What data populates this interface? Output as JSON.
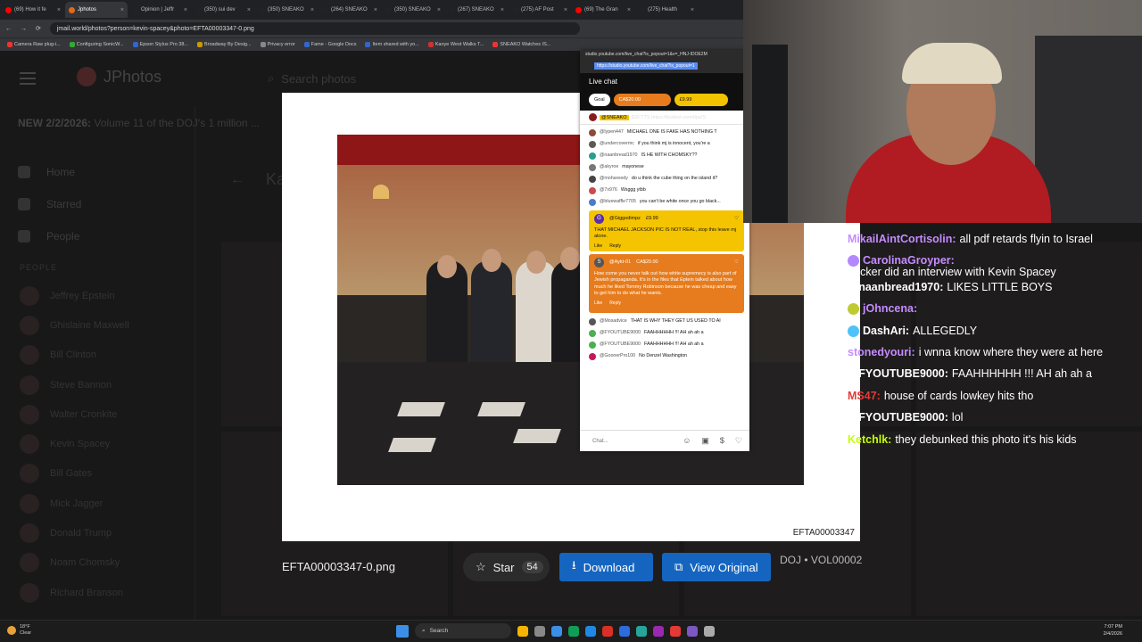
{
  "browser": {
    "tabs": [
      {
        "label": "(69) How it fe",
        "color": "#ff0000"
      },
      {
        "label": "Jphotos",
        "color": "#e06a1b",
        "active": true
      },
      {
        "label": "Opinion | Jeffr",
        "color": "#222222"
      },
      {
        "label": "(350) sui dev",
        "color": "#222222"
      },
      {
        "label": "(350) SNEAKO",
        "color": "#222222"
      },
      {
        "label": "(264) SNEAKO",
        "color": "#222222"
      },
      {
        "label": "(350) SNEAKO",
        "color": "#222222"
      },
      {
        "label": "(267) SNEAKO",
        "color": "#222222"
      },
      {
        "label": "(275) AF Post",
        "color": "#222222"
      },
      {
        "label": "(69) The Gran",
        "color": "#ff0000"
      },
      {
        "label": "(275) Health",
        "color": "#222222"
      }
    ],
    "url": "jmail.world/photos?person=kevin-spacey&photo=EFTA00003347-0.png",
    "bookmarks": [
      {
        "label": "Camera Raw plug-i...",
        "color": "#e33"
      },
      {
        "label": "Configuring SonicW...",
        "color": "#3a3"
      },
      {
        "label": "Epson Stylus Pro 38...",
        "color": "#36c"
      },
      {
        "label": "Broadway By Desig...",
        "color": "#c90"
      },
      {
        "label": "Privacy error",
        "color": "#888"
      },
      {
        "label": "Fame - Google Docs",
        "color": "#36c"
      },
      {
        "label": "Item shared with yo...",
        "color": "#36c"
      },
      {
        "label": "Kanye West Walks T...",
        "color": "#c33"
      },
      {
        "label": "SNEAKO Watches IS...",
        "color": "#e33"
      }
    ]
  },
  "app": {
    "brand": "JPhotos",
    "search_placeholder": "Search photos",
    "banner_new": "NEW 2/2/2026:",
    "banner_text": "Volume 11 of the DOJ's 1 million ...",
    "nav": [
      "Home",
      "Starred",
      "People"
    ],
    "people_heading": "PEOPLE",
    "people": [
      "Jeffrey Epstein",
      "Ghislaine Maxwell",
      "Bill Clinton",
      "Steve Bannon",
      "Walter Cronkite",
      "Kevin Spacey",
      "Bill Gates",
      "Mick Jagger",
      "Donald Trump",
      "Noam Chomsky",
      "Richard Branson"
    ],
    "page_title_peek": "Ka"
  },
  "viewer": {
    "doc_id": "EFTA00003347",
    "filename": "EFTA00003347-0.png",
    "star_label": "Star",
    "star_count": "54",
    "download_label": "Download",
    "view_original_label": "View Original",
    "meta": "DOJ • VOL00002"
  },
  "ytchat": {
    "url": "studio.youtube.com/live_chat?is_popout=1&v=_HNJ-IDOE2M",
    "url_highlight": "https://studio.youtube.com/live_chat?is_popout=1",
    "title": "Live chat",
    "chips": [
      "Goal",
      "CA$20.00",
      "£9.99"
    ],
    "pinned_author": "@SNEAKO",
    "pinned_text": "$30 TTS https://kickbot.com/tips/S",
    "messages_top": [
      {
        "author": "@lypen447",
        "text": "MICHAEL ONE IS FAKE HAS NOTHING T",
        "color": "#8a4b3b"
      },
      {
        "author": "@undercovermc",
        "text": "if you think mj is innocent, you're a",
        "color": "#5a5a5a"
      },
      {
        "author": "@naanbread1970",
        "text": "IS HE WITH CHOMSKY??",
        "color": "#2a9d8f"
      },
      {
        "author": "@akyroe",
        "text": "mayonese",
        "color": "#777777"
      },
      {
        "author": "@mohareedy",
        "text": "do u think the cube thing on the island it?",
        "color": "#444444"
      },
      {
        "author": "@7x976",
        "text": "Wsggg ytbb",
        "color": "#c94b4b"
      },
      {
        "author": "@bluewaffle7705",
        "text": "you can't be white once you go black...",
        "color": "#4b7bc9"
      }
    ],
    "superchat_yellow": {
      "author": "@Giggodimpz",
      "amount": "£9.99",
      "text": "THAT MICHAEL JACKSON PIC IS NOT REAL, stop this leave mj alone.",
      "like": "Like",
      "reply": "Reply"
    },
    "superchat_orange": {
      "author": "@Aykt-01",
      "amount": "CA$20.00",
      "text": "How come you never talk out how white supremecy is also part of Jewish propaganda. It's in the files that Eptein talked about how much he liked Tommy Robinson because he was cheap and easy to get him to do what he wants.",
      "like": "Like",
      "reply": "Reply"
    },
    "messages_bottom": [
      {
        "author": "@Mosadvice",
        "text": "THAT IS WHY THEY GET US USED TO AI",
        "color": "#555555"
      },
      {
        "author": "@FYOUTUBE9000",
        "text": "FAAHHHHHH !!! AH ah ah a",
        "color": "#4caf50"
      },
      {
        "author": "@FYOUTUBE9000",
        "text": "FAAHHHHHH !!! AH ah ah a",
        "color": "#4caf50"
      },
      {
        "author": "@GoonerPro100",
        "text": "No Denzel Washington",
        "color": "#c2185b"
      }
    ],
    "input_placeholder": "Chat..."
  },
  "overlay": [
    {
      "name": "MikailAintCortisolin:",
      "text": "all pdf retards flyin to Israel",
      "color": "#c58cff"
    },
    {
      "name": "CarolinaGroyper:",
      "text": "Tucker did an interview with Kevin Spacey",
      "color": "#c58cff",
      "badge": "#b388ff"
    },
    {
      "name": "@naanbread1970:",
      "text": "LIKES LITTLE BOYS",
      "color": "#ffffff"
    },
    {
      "name": "jOhncena:",
      "text": "",
      "color": "#c58cff",
      "badge": "#c0ca33"
    },
    {
      "name": "DashAri:",
      "text": "ALLEGEDLY",
      "color": "#ffffff",
      "badge": "#4fc3f7"
    },
    {
      "name": "stonedyouri:",
      "text": "i wnna know where they were at here",
      "color": "#c58cff"
    },
    {
      "name": "@FYOUTUBE9000:",
      "text": "FAAHHHHHH !!! AH ah ah a",
      "color": "#ffffff"
    },
    {
      "name": "MS47:",
      "text": "house of cards lowkey hits tho",
      "color": "#e53935"
    },
    {
      "name": "@FYOUTUBE9000:",
      "text": "lol",
      "color": "#ffffff"
    },
    {
      "name": "Ketchlk:",
      "text": "they debunked this photo it's his kids",
      "color": "#c6ff00"
    }
  ],
  "taskbar": {
    "weather_temp": "18°F",
    "weather_desc": "Clear",
    "search_label": "Search",
    "time": "7:07 PM",
    "date": "2/4/2026",
    "apps": [
      "#f4b400",
      "#888888",
      "#3c8fe6",
      "#0f9d58",
      "#1e88e5",
      "#d93025",
      "#2d6cdf",
      "#26a69a",
      "#9c27b0",
      "#e53935",
      "#7e57c2",
      "#aaaaaa"
    ]
  }
}
